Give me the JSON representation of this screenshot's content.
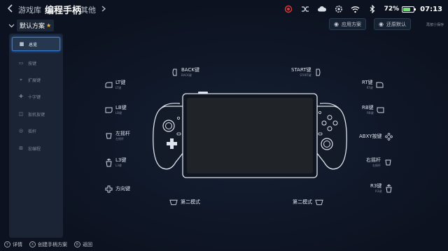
{
  "top_bar": {
    "tabs": [
      {
        "label": "游戏库"
      },
      {
        "label": "编程手柄"
      },
      {
        "label": "其他"
      }
    ],
    "battery_percent": "72%",
    "battery_level": 0.72,
    "clock": "07:13",
    "icons": [
      "record-icon",
      "shuffle-icon",
      "cloud-icon",
      "settings-icon",
      "wifi-icon",
      "bluetooth-icon"
    ],
    "record_color": "#e0373b"
  },
  "scheme": {
    "name": "默认方案",
    "apply_label": "应用方案",
    "reset_label": "还原默认",
    "hint": "再按Ⓨ保存"
  },
  "sidebar": {
    "items": [
      {
        "label": "总览",
        "icon": "grid-icon"
      },
      {
        "label": "按键",
        "icon": "button-icon"
      },
      {
        "label": "扩展键",
        "icon": "extend-icon"
      },
      {
        "label": "十字键",
        "icon": "dpad-icon"
      },
      {
        "label": "扳机扳键",
        "icon": "trigger-icon"
      },
      {
        "label": "摇杆",
        "icon": "stick-icon"
      },
      {
        "label": "宏编程",
        "icon": "macro-icon"
      }
    ]
  },
  "mappings": {
    "lt": {
      "label": "LT键",
      "sub": "LT键"
    },
    "lb": {
      "label": "LB键",
      "sub": "LB键"
    },
    "left_stick": {
      "label": "左摇杆",
      "sub": "左摇杆"
    },
    "l3": {
      "label": "L3键",
      "sub": "L3键"
    },
    "dpad": {
      "label": "方向键",
      "sub": ""
    },
    "back": {
      "label": "BACK键",
      "sub": "BACK键"
    },
    "start": {
      "label": "START键",
      "sub": "START键"
    },
    "rt": {
      "label": "RT键",
      "sub": "RT键"
    },
    "rb": {
      "label": "RB键",
      "sub": "RB键"
    },
    "abxy": {
      "label": "ABXY按键",
      "sub": ""
    },
    "right_stick": {
      "label": "右摇杆",
      "sub": "右摇杆"
    },
    "r3": {
      "label": "R3键",
      "sub": "R3键"
    },
    "mode_left": {
      "label": "第二模式",
      "sub": ""
    },
    "mode_right": {
      "label": "第二模式",
      "sub": ""
    }
  },
  "bottom_bar": {
    "items": [
      {
        "key": "Y",
        "label": "详情"
      },
      {
        "key": "X",
        "label": "创建手柄方案"
      },
      {
        "key": "B",
        "label": "返回"
      }
    ]
  }
}
